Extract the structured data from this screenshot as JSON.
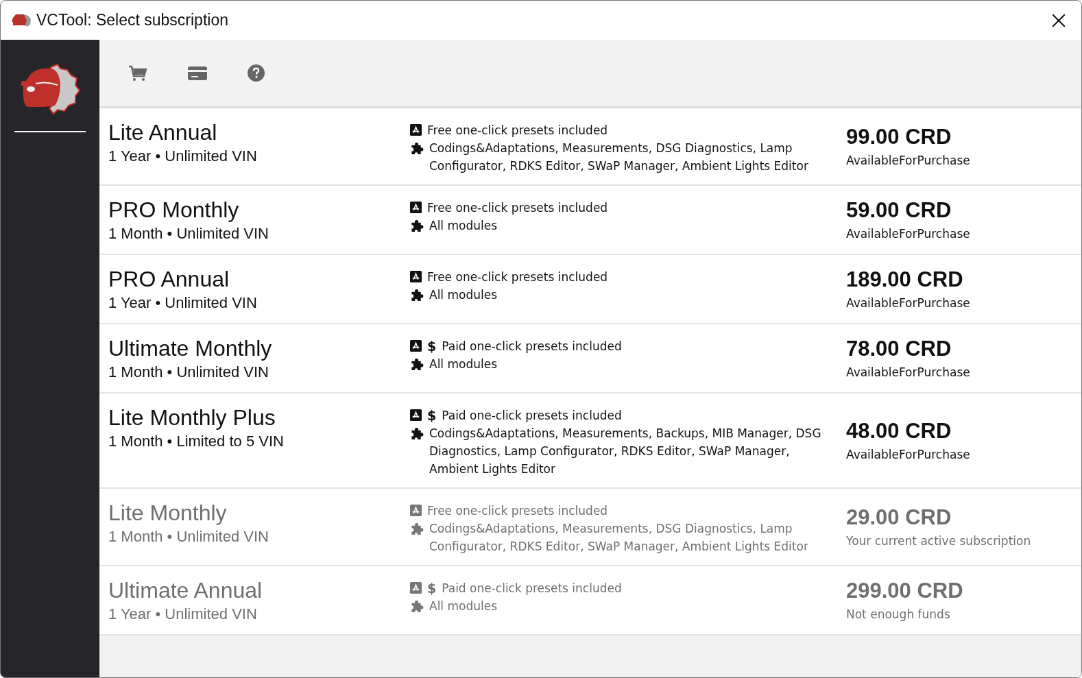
{
  "window": {
    "title": "VCTool: Select subscription"
  },
  "toolbar": {
    "buttons": [
      {
        "kind": "cart"
      },
      {
        "kind": "card"
      },
      {
        "kind": "help"
      }
    ]
  },
  "subscriptions": [
    {
      "name": "Lite Annual",
      "terms": "1 Year • Unlimited VIN",
      "presets": {
        "text": "Free one-click presets included"
      },
      "modules": "Codings&Adaptations, Measurements, DSG Diagnostics, Lamp Configurator, RDKS Editor, SWaP Manager, Ambient Lights Editor",
      "price": "99.00 CRD",
      "status": "AvailableForPurchase",
      "disabled": false
    },
    {
      "name": "PRO Monthly",
      "terms": "1 Month • Unlimited VIN",
      "presets": {
        "text": "Free one-click presets included"
      },
      "modules": "All modules",
      "price": "59.00 CRD",
      "status": "AvailableForPurchase",
      "disabled": false
    },
    {
      "name": "PRO Annual",
      "terms": "1 Year • Unlimited VIN",
      "presets": {
        "text": "Free one-click presets included"
      },
      "modules": "All modules",
      "price": "189.00 CRD",
      "status": "AvailableForPurchase",
      "disabled": false
    },
    {
      "name": "Ultimate Monthly",
      "terms": "1 Month • Unlimited VIN",
      "presets": {
        "paid_mark": "$",
        "text": "Paid one-click presets included"
      },
      "modules": "All modules",
      "price": "78.00 CRD",
      "status": "AvailableForPurchase",
      "disabled": false
    },
    {
      "name": "Lite Monthly Plus",
      "terms": "1 Month • Limited to 5 VIN",
      "presets": {
        "paid_mark": "$",
        "text": "Paid one-click presets included"
      },
      "modules": "Codings&Adaptations, Measurements, Backups, MIB Manager, DSG Diagnostics, Lamp Configurator, RDKS Editor, SWaP Manager, Ambient Lights Editor",
      "price": "48.00 CRD",
      "status": "AvailableForPurchase",
      "disabled": false
    },
    {
      "name": "Lite Monthly",
      "terms": "1 Month • Unlimited VIN",
      "presets": {
        "text": "Free one-click presets included"
      },
      "modules": "Codings&Adaptations, Measurements, DSG Diagnostics, Lamp Configurator, RDKS Editor, SWaP Manager, Ambient Lights Editor",
      "price": "29.00 CRD",
      "status": "Your current active subscription",
      "disabled": true
    },
    {
      "name": "Ultimate Annual",
      "terms": "1 Year • Unlimited VIN",
      "presets": {
        "paid_mark": "$",
        "text": "Paid one-click presets included"
      },
      "modules": "All modules",
      "price": "299.00 CRD",
      "status": "Not enough funds",
      "disabled": true
    }
  ]
}
